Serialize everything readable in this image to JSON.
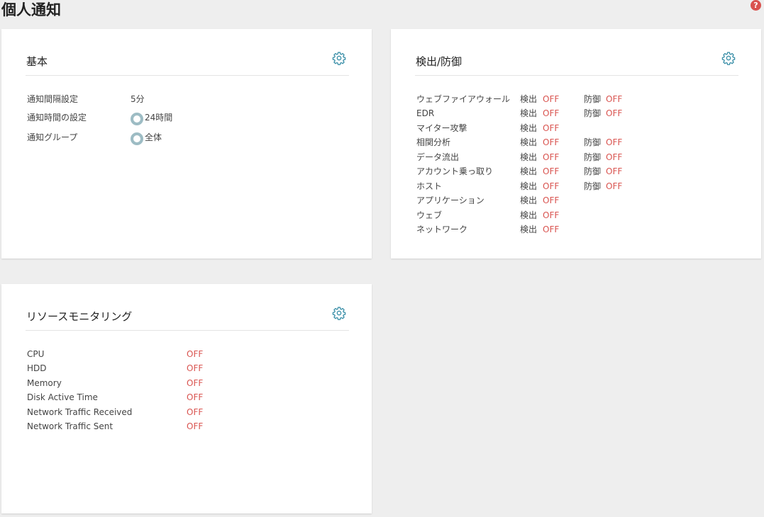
{
  "page": {
    "title": "個人通知",
    "help_icon": "?"
  },
  "colors": {
    "off": "#d9534f",
    "accent": "#3a8fa8",
    "radio": "#9dbcc4"
  },
  "basic": {
    "title": "基本",
    "settings_icon": "gear-icon",
    "rows": [
      {
        "label": "通知間隔設定",
        "value": "5分"
      },
      {
        "label": "通知時間の設定",
        "value": "24時間"
      },
      {
        "label": "通知グループ",
        "value": "全体"
      }
    ]
  },
  "detect": {
    "title": "検出/防御",
    "settings_icon": "gear-icon",
    "detect_label": "検出",
    "defend_label": "防御",
    "off_label": "OFF",
    "rows": [
      {
        "label": "ウェブファイアウォール",
        "detect": "OFF",
        "defend": "OFF"
      },
      {
        "label": "EDR",
        "detect": "OFF",
        "defend": "OFF"
      },
      {
        "label": "マイター攻撃",
        "detect": "OFF"
      },
      {
        "label": "相関分析",
        "detect": "OFF",
        "defend": "OFF"
      },
      {
        "label": "データ流出",
        "detect": "OFF",
        "defend": "OFF"
      },
      {
        "label": "アカウント乗っ取り",
        "detect": "OFF",
        "defend": "OFF"
      },
      {
        "label": "ホスト",
        "detect": "OFF",
        "defend": "OFF"
      },
      {
        "label": "アプリケーション",
        "detect": "OFF"
      },
      {
        "label": "ウェブ",
        "detect": "OFF"
      },
      {
        "label": "ネットワーク",
        "detect": "OFF"
      }
    ]
  },
  "resource": {
    "title": "リソースモニタリング",
    "settings_icon": "gear-icon",
    "rows": [
      {
        "label": "CPU",
        "value": "OFF"
      },
      {
        "label": "HDD",
        "value": "OFF"
      },
      {
        "label": "Memory",
        "value": "OFF"
      },
      {
        "label": "Disk Active Time",
        "value": "OFF"
      },
      {
        "label": "Network Traffic Received",
        "value": "OFF"
      },
      {
        "label": "Network Traffic Sent",
        "value": "OFF"
      }
    ]
  }
}
